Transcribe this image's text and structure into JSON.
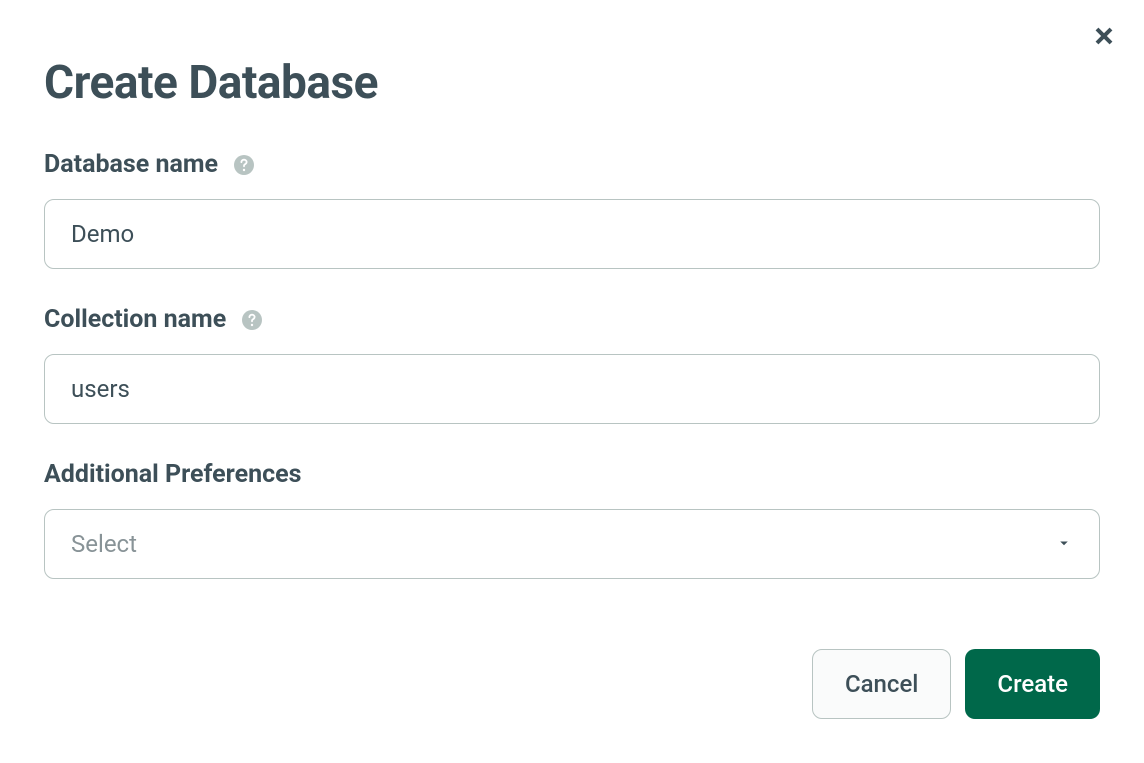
{
  "modal": {
    "title": "Create Database",
    "fields": {
      "database_name": {
        "label": "Database name",
        "value": "Demo"
      },
      "collection_name": {
        "label": "Collection name",
        "value": "users"
      },
      "additional_preferences": {
        "label": "Additional Preferences",
        "placeholder": "Select"
      }
    },
    "buttons": {
      "cancel": "Cancel",
      "create": "Create"
    }
  }
}
